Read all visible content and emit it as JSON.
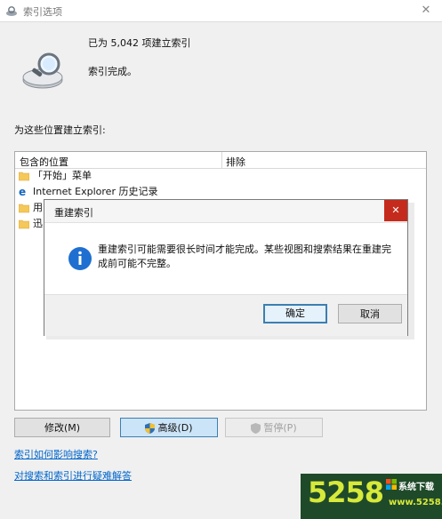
{
  "window": {
    "title": "索引选项",
    "close_glyph": "✕"
  },
  "status": {
    "indexed_count": "已为 5,042 项建立索引",
    "state": "索引完成。"
  },
  "locations": {
    "label": "为这些位置建立索引:",
    "columns": {
      "include": "包含的位置",
      "exclude": "排除"
    },
    "rows": [
      {
        "label": "「开始」菜单",
        "icon": "folder-icon"
      },
      {
        "label": "Internet Explorer 历史记录",
        "icon": "ie-icon"
      },
      {
        "label": "用",
        "icon": "folder-icon"
      },
      {
        "label": "迅",
        "icon": "folder-icon"
      }
    ]
  },
  "buttons": {
    "modify": "修改(M)",
    "advanced": "高级(D)",
    "pause": "暂停(P)"
  },
  "links": {
    "affect_search": "索引如何影响搜索?",
    "troubleshoot": "对搜索和索引进行疑难解答"
  },
  "dialog": {
    "title": "重建索引",
    "close_glyph": "✕",
    "message": "重建索引可能需要很长时间才能完成。某些视图和搜索结果在重建完成前可能不完整。",
    "ok": "确定",
    "cancel": "取消"
  },
  "watermark": {
    "number": "5258",
    "brand": "系统下载",
    "site": "www.5258.cn"
  },
  "colors": {
    "accent": "#3c7fb1",
    "link": "#0066cc",
    "dialog_close": "#c42b1c",
    "folder": "#f5c85a"
  }
}
